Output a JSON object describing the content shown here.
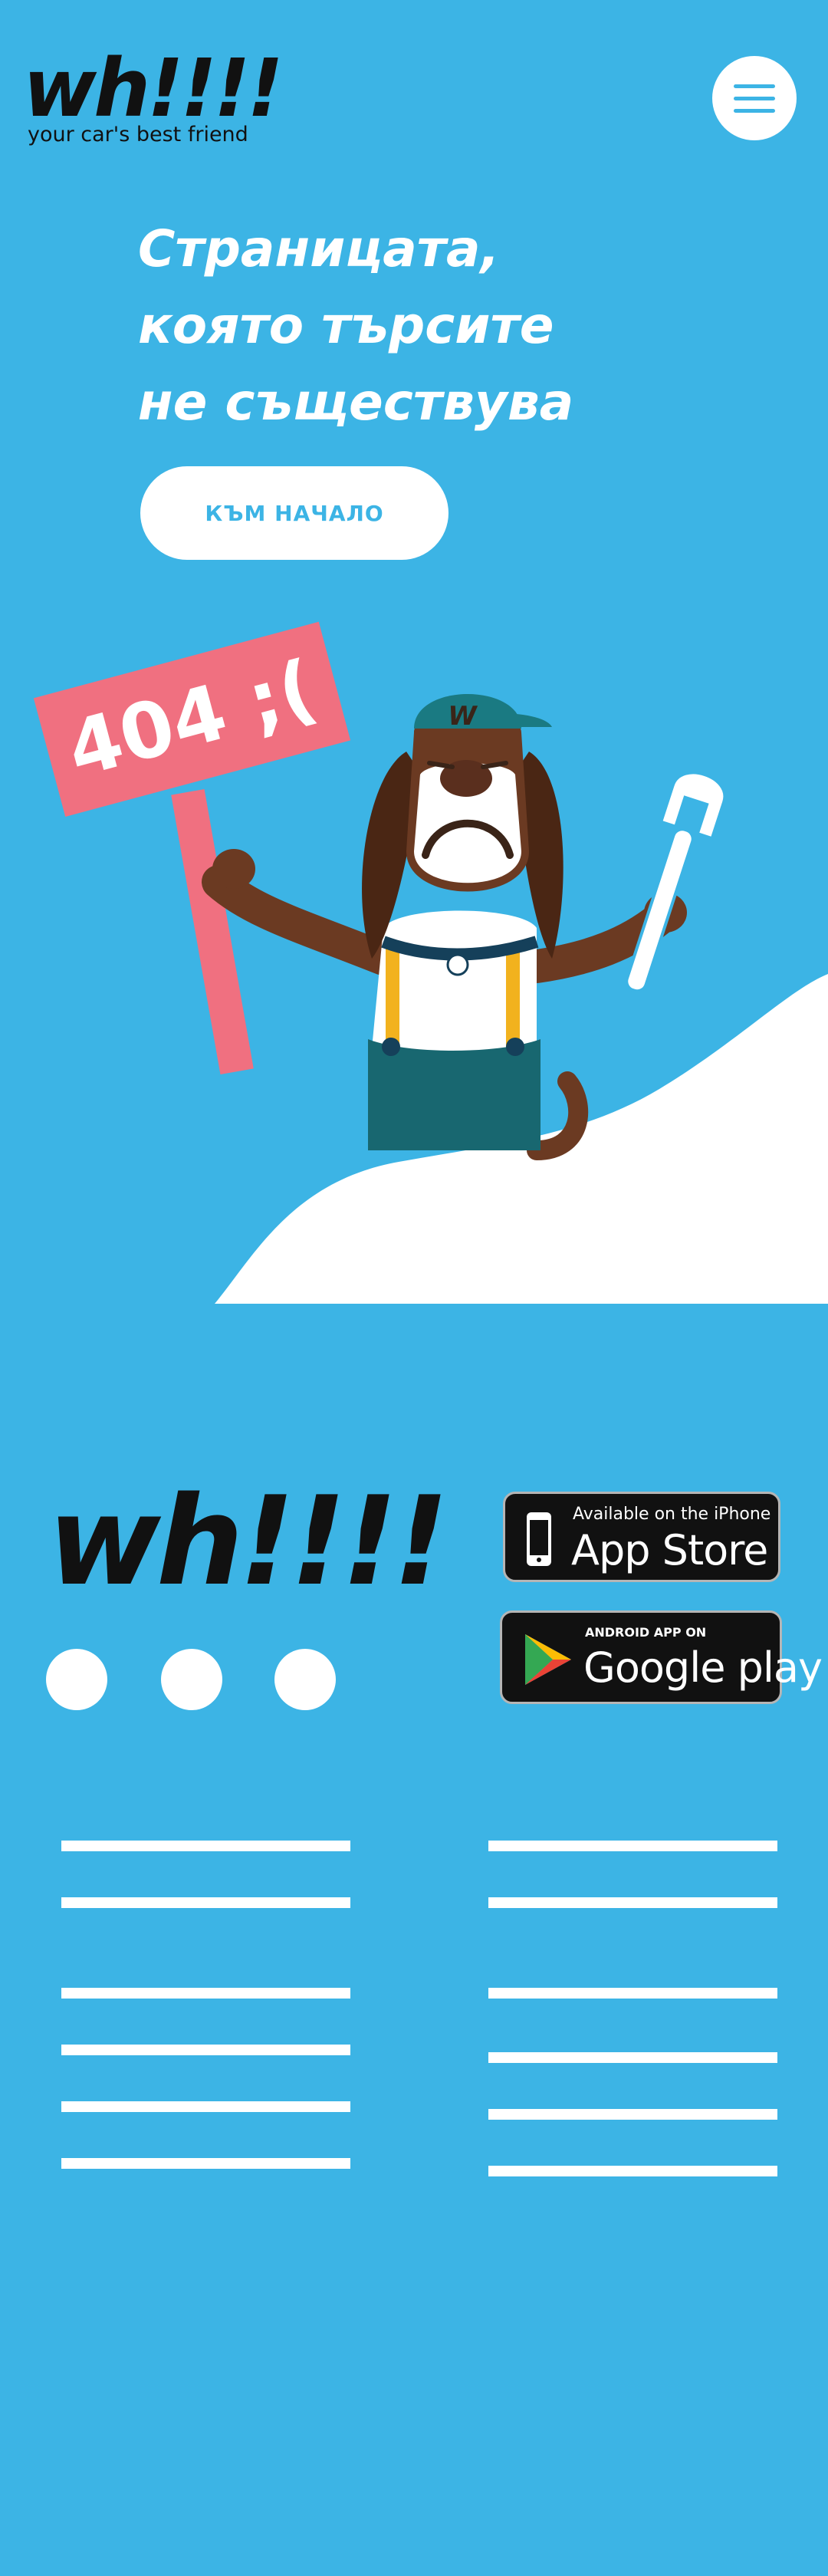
{
  "header": {
    "logo_text": "wh!!!!",
    "tagline": "your car's best friend",
    "menu_icon": "hamburger-icon"
  },
  "hero": {
    "headline_lines": [
      "Страницата,",
      "която търсите",
      "не съществува"
    ],
    "home_button_label": "КЪМ НАЧАЛО",
    "sign_text": "404 ;(",
    "cap_letter": "W"
  },
  "footer": {
    "logo_text": "wh!!!!",
    "app_store": {
      "small": "Available on the iPhone",
      "big": "App Store"
    },
    "google_play": {
      "small": "ANDROID APP ON",
      "big": "Google play"
    },
    "social_icons": [
      "social-icon-1",
      "social-icon-2",
      "social-icon-3"
    ]
  },
  "colors": {
    "background": "#3cb4e5",
    "white": "#ffffff",
    "sign": "#f07080",
    "dog_brown": "#6b3a22",
    "cap": "#1a7a82",
    "suspenders": "#f2b21e",
    "pants": "#186770"
  }
}
